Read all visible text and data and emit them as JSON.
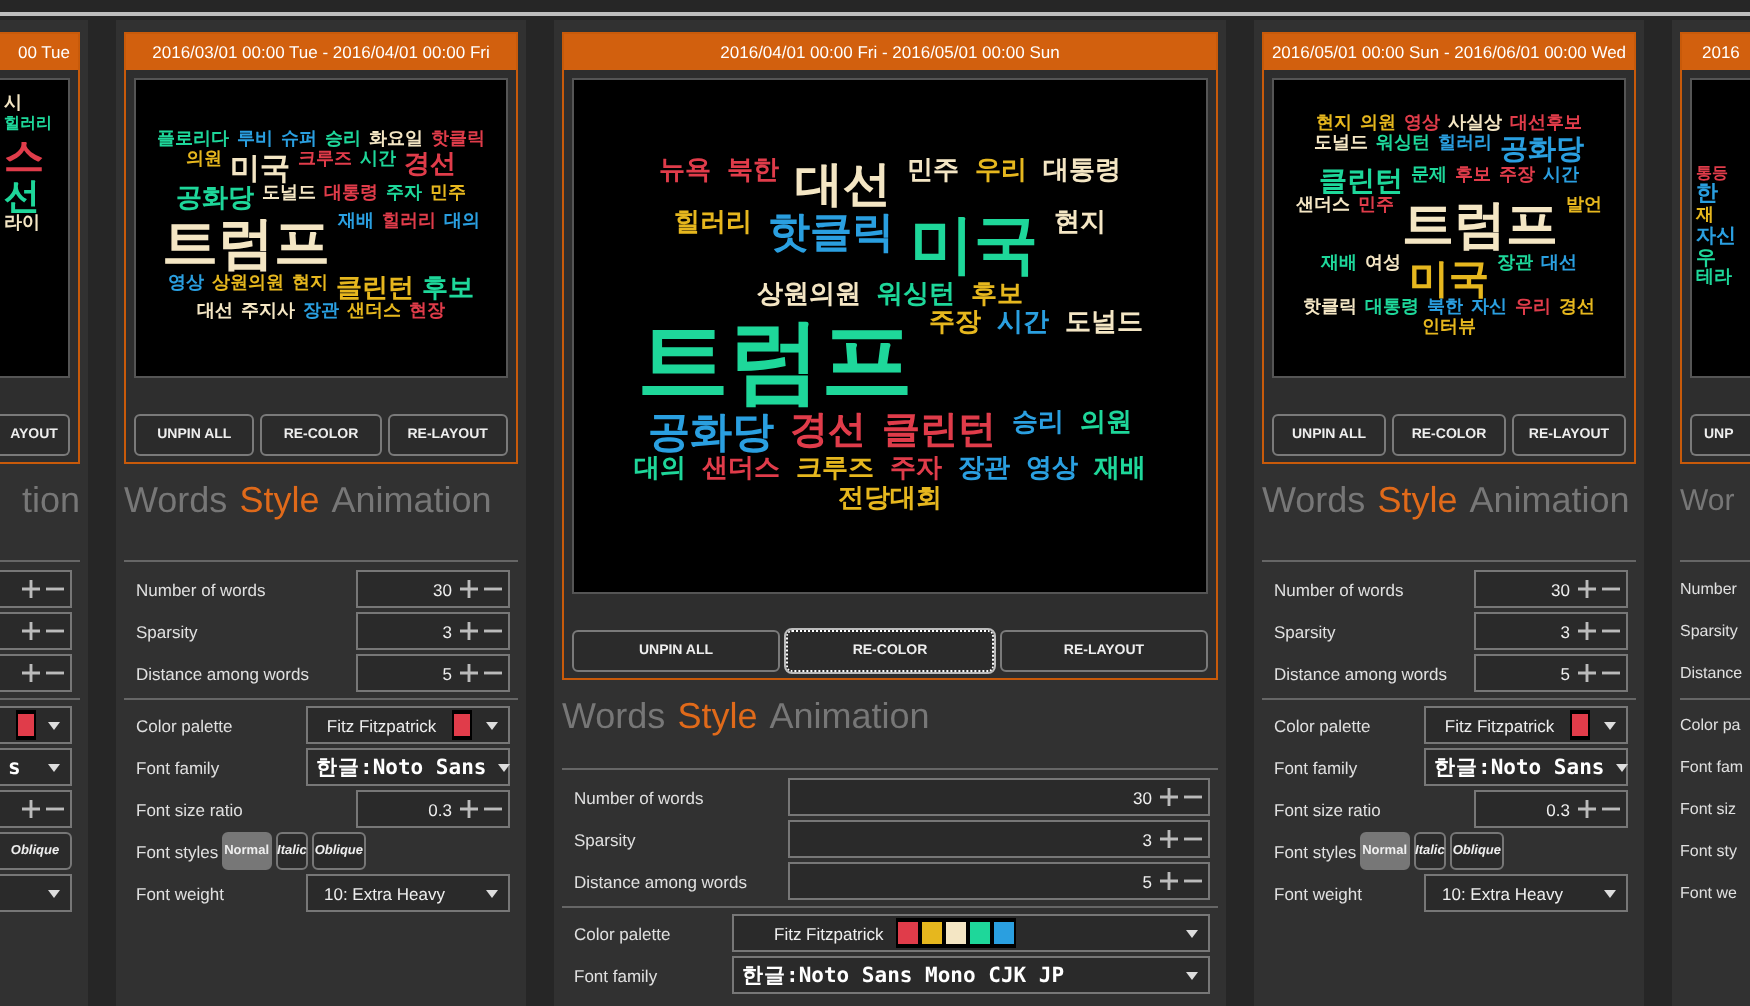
{
  "panels": [
    {
      "kind": "partial-left",
      "range": "00 Tue",
      "words": [
        {
          "text": "시",
          "color": "#f4e6c4"
        },
        {
          "text": "힐러리",
          "color": "#1ed79a"
        },
        {
          "text": "스",
          "color": "#e03c4a"
        },
        {
          "text": "선",
          "color": "#1ed79a"
        },
        {
          "text": "라이",
          "color": "#f4e6c4"
        }
      ],
      "buttons": [
        {
          "label": "AYOUT",
          "focused": false
        }
      ],
      "tabs": [
        {
          "label": "tion",
          "selected": false
        }
      ],
      "settings": [
        {
          "kind": "number"
        },
        {
          "kind": "number"
        },
        {
          "kind": "number"
        },
        {
          "kind": "palette",
          "swatches": [
            {
              "color": "#e03c4a"
            }
          ]
        },
        {
          "kind": "font",
          "value": "s"
        },
        {
          "kind": "number"
        },
        {
          "kind": "styles",
          "options": [
            {
              "label": "Oblique",
              "selected": false
            }
          ]
        },
        {
          "kind": "select"
        }
      ]
    },
    {
      "kind": "full",
      "range": "2016/03/01 00:00 Tue - 2016/04/01 00:00 Fri",
      "words": [
        {
          "text": "플로리다",
          "color": "#1ed79a"
        },
        {
          "text": "루비",
          "color": "#2a9fe0"
        },
        {
          "text": "슈퍼",
          "color": "#2a9fe0"
        },
        {
          "text": "승리",
          "color": "#1ed79a"
        },
        {
          "text": "화요일",
          "color": "#f4e6c4"
        },
        {
          "text": "핫클릭",
          "color": "#e03c4a"
        },
        {
          "text": "의원",
          "color": "#e6b71e"
        },
        {
          "text": "미국",
          "color": "#f4e6c4"
        },
        {
          "text": "크루즈",
          "color": "#e03c4a"
        },
        {
          "text": "시간",
          "color": "#1ed79a"
        },
        {
          "text": "경선",
          "color": "#e03c4a"
        },
        {
          "text": "공화당",
          "color": "#1ed79a"
        },
        {
          "text": "도널드",
          "color": "#f4e6c4"
        },
        {
          "text": "대통령",
          "color": "#e03c4a"
        },
        {
          "text": "주자",
          "color": "#1ed79a"
        },
        {
          "text": "민주",
          "color": "#e6b71e"
        },
        {
          "text": "트럼프",
          "color": "#f4e6c4"
        },
        {
          "text": "재배",
          "color": "#2a9fe0"
        },
        {
          "text": "힐러리",
          "color": "#e03c4a"
        },
        {
          "text": "대의",
          "color": "#2a9fe0"
        },
        {
          "text": "영상",
          "color": "#2a9fe0"
        },
        {
          "text": "상원의원",
          "color": "#e6b71e"
        },
        {
          "text": "현지",
          "color": "#e6b71e"
        },
        {
          "text": "클린턴",
          "color": "#e6b71e"
        },
        {
          "text": "후보",
          "color": "#1ed79a"
        },
        {
          "text": "대선",
          "color": "#f4e6c4"
        },
        {
          "text": "주지사",
          "color": "#f4e6c4"
        },
        {
          "text": "장관",
          "color": "#2a9fe0"
        },
        {
          "text": "샌더스",
          "color": "#e6b71e"
        },
        {
          "text": "현장",
          "color": "#e03c4a"
        }
      ],
      "buttons": [
        {
          "label": "UNPIN ALL",
          "focused": false
        },
        {
          "label": "RE-COLOR",
          "focused": false
        },
        {
          "label": "RE-LAYOUT",
          "focused": false
        }
      ],
      "tabs": [
        {
          "label": "Words",
          "selected": false
        },
        {
          "label": "Style",
          "selected": true
        },
        {
          "label": "Animation",
          "selected": false
        }
      ],
      "settings": [
        {
          "kind": "number",
          "label": "Number of words",
          "value": "30"
        },
        {
          "kind": "number",
          "label": "Sparsity",
          "value": "3"
        },
        {
          "kind": "number",
          "label": "Distance among words",
          "value": "5"
        },
        {
          "kind": "palette",
          "label": "Color palette",
          "value": "Fitz Fitzpatrick",
          "swatches": [
            {
              "color": "#e03c4a"
            }
          ]
        },
        {
          "kind": "font",
          "label": "Font family",
          "value": "한글:Noto Sans"
        },
        {
          "kind": "number",
          "label": "Font size ratio",
          "value": "0.3"
        },
        {
          "kind": "styles",
          "label": "Font styles",
          "options": [
            {
              "label": "Normal",
              "selected": true
            },
            {
              "label": "Italic",
              "selected": false
            },
            {
              "label": "Oblique",
              "selected": false
            }
          ]
        },
        {
          "kind": "select",
          "label": "Font weight",
          "value": "10: Extra Heavy"
        }
      ]
    },
    {
      "kind": "wide",
      "range": "2016/04/01 00:00 Fri - 2016/05/01 00:00 Sun",
      "words": [
        {
          "text": "뉴욕",
          "color": "#e03c4a"
        },
        {
          "text": "북한",
          "color": "#e03c4a"
        },
        {
          "text": "대선",
          "color": "#f4e6c4"
        },
        {
          "text": "민주",
          "color": "#f4e6c4"
        },
        {
          "text": "우리",
          "color": "#e6b71e"
        },
        {
          "text": "대통령",
          "color": "#f4e6c4"
        },
        {
          "text": "힐러리",
          "color": "#e6b71e"
        },
        {
          "text": "핫클릭",
          "color": "#2a9fe0"
        },
        {
          "text": "미국",
          "color": "#1ed79a"
        },
        {
          "text": "현지",
          "color": "#f4e6c4"
        },
        {
          "text": "상원의원",
          "color": "#f4e6c4"
        },
        {
          "text": "워싱턴",
          "color": "#1ed79a"
        },
        {
          "text": "후보",
          "color": "#e6b71e"
        },
        {
          "text": "트럼프",
          "color": "#1ed79a"
        },
        {
          "text": "주장",
          "color": "#e6b71e"
        },
        {
          "text": "시간",
          "color": "#2a9fe0"
        },
        {
          "text": "도널드",
          "color": "#f4e6c4"
        },
        {
          "text": "공화당",
          "color": "#2a9fe0"
        },
        {
          "text": "경선",
          "color": "#e03c4a"
        },
        {
          "text": "클린턴",
          "color": "#e03c4a"
        },
        {
          "text": "승리",
          "color": "#2a9fe0"
        },
        {
          "text": "의원",
          "color": "#1ed79a"
        },
        {
          "text": "대의",
          "color": "#1ed79a"
        },
        {
          "text": "샌더스",
          "color": "#e03c4a"
        },
        {
          "text": "크루즈",
          "color": "#e6b71e"
        },
        {
          "text": "주자",
          "color": "#e03c4a"
        },
        {
          "text": "장관",
          "color": "#2a9fe0"
        },
        {
          "text": "영상",
          "color": "#2a9fe0"
        },
        {
          "text": "재배",
          "color": "#1ed79a"
        },
        {
          "text": "전당대회",
          "color": "#e6b71e"
        }
      ],
      "buttons": [
        {
          "label": "UNPIN ALL",
          "focused": false
        },
        {
          "label": "RE-COLOR",
          "focused": true
        },
        {
          "label": "RE-LAYOUT",
          "focused": false
        }
      ],
      "tabs": [
        {
          "label": "Words",
          "selected": false
        },
        {
          "label": "Style",
          "selected": true
        },
        {
          "label": "Animation",
          "selected": false
        }
      ],
      "settings": [
        {
          "kind": "number",
          "label": "Number of words",
          "value": "30"
        },
        {
          "kind": "number",
          "label": "Sparsity",
          "value": "3"
        },
        {
          "kind": "number",
          "label": "Distance among words",
          "value": "5"
        },
        {
          "kind": "palette",
          "label": "Color palette",
          "value": "Fitz Fitzpatrick",
          "swatches": [
            {
              "color": "#e03c4a"
            },
            {
              "color": "#e6b71e"
            },
            {
              "color": "#f4e6c4"
            },
            {
              "color": "#1ed79a"
            },
            {
              "color": "#2a9fe0"
            }
          ]
        },
        {
          "kind": "font",
          "label": "Font family",
          "value": "한글:Noto Sans Mono CJK JP"
        }
      ]
    },
    {
      "kind": "full",
      "range": "2016/05/01 00:00 Sun - 2016/06/01 00:00 Wed",
      "words": [
        {
          "text": "현지",
          "color": "#e6b71e"
        },
        {
          "text": "의원",
          "color": "#e6b71e"
        },
        {
          "text": "영상",
          "color": "#e03c4a"
        },
        {
          "text": "사실상",
          "color": "#f4e6c4"
        },
        {
          "text": "대선후보",
          "color": "#e03c4a"
        },
        {
          "text": "도널드",
          "color": "#f4e6c4"
        },
        {
          "text": "워싱턴",
          "color": "#1ed79a"
        },
        {
          "text": "힐러리",
          "color": "#2a9fe0"
        },
        {
          "text": "공화당",
          "color": "#2a9fe0"
        },
        {
          "text": "클린턴",
          "color": "#1ed79a"
        },
        {
          "text": "문제",
          "color": "#1ed79a"
        },
        {
          "text": "후보",
          "color": "#e03c4a"
        },
        {
          "text": "주장",
          "color": "#e03c4a"
        },
        {
          "text": "시간",
          "color": "#2a9fe0"
        },
        {
          "text": "샌더스",
          "color": "#f4e6c4"
        },
        {
          "text": "민주",
          "color": "#e03c4a"
        },
        {
          "text": "트럼프",
          "color": "#f4e6c4"
        },
        {
          "text": "발언",
          "color": "#e6b71e"
        },
        {
          "text": "재배",
          "color": "#1ed79a"
        },
        {
          "text": "여성",
          "color": "#f4e6c4"
        },
        {
          "text": "미국",
          "color": "#e6b71e"
        },
        {
          "text": "장관",
          "color": "#1ed79a"
        },
        {
          "text": "대선",
          "color": "#2a9fe0"
        },
        {
          "text": "핫클릭",
          "color": "#f4e6c4"
        },
        {
          "text": "대통령",
          "color": "#1ed79a"
        },
        {
          "text": "북한",
          "color": "#2a9fe0"
        },
        {
          "text": "자신",
          "color": "#2a9fe0"
        },
        {
          "text": "우리",
          "color": "#e03c4a"
        },
        {
          "text": "경선",
          "color": "#e6b71e"
        },
        {
          "text": "인터뷰",
          "color": "#e6b71e"
        }
      ],
      "buttons": [
        {
          "label": "UNPIN ALL",
          "focused": false
        },
        {
          "label": "RE-COLOR",
          "focused": false
        },
        {
          "label": "RE-LAYOUT",
          "focused": false
        }
      ],
      "tabs": [
        {
          "label": "Words",
          "selected": false
        },
        {
          "label": "Style",
          "selected": true
        },
        {
          "label": "Animation",
          "selected": false
        }
      ],
      "settings": [
        {
          "kind": "number",
          "label": "Number of words",
          "value": "30"
        },
        {
          "kind": "number",
          "label": "Sparsity",
          "value": "3"
        },
        {
          "kind": "number",
          "label": "Distance among words",
          "value": "5"
        },
        {
          "kind": "palette",
          "label": "Color palette",
          "value": "Fitz Fitzpatrick",
          "swatches": [
            {
              "color": "#e03c4a"
            }
          ]
        },
        {
          "kind": "font",
          "label": "Font family",
          "value": "한글:Noto Sans"
        },
        {
          "kind": "number",
          "label": "Font size ratio",
          "value": "0.3"
        },
        {
          "kind": "styles",
          "label": "Font styles",
          "options": [
            {
              "label": "Normal",
              "selected": true
            },
            {
              "label": "Italic",
              "selected": false
            },
            {
              "label": "Oblique",
              "selected": false
            }
          ]
        },
        {
          "kind": "select",
          "label": "Font weight",
          "value": "10: Extra Heavy"
        }
      ]
    },
    {
      "kind": "partial-right",
      "range": "2016",
      "words": [
        {
          "text": "통등",
          "color": "#e03c4a"
        },
        {
          "text": "한",
          "color": "#2a9fe0"
        },
        {
          "text": "재",
          "color": "#e6b71e"
        },
        {
          "text": "자신",
          "color": "#2a9fe0"
        },
        {
          "text": "우",
          "color": "#1ed79a"
        },
        {
          "text": "테라",
          "color": "#1ed79a"
        }
      ],
      "buttons": [
        {
          "label": "UNP",
          "focused": false
        }
      ],
      "tabs": [
        {
          "label": "Wor",
          "selected": false
        }
      ],
      "settings": [
        {
          "kind": "number",
          "label": "Number"
        },
        {
          "kind": "number",
          "label": "Sparsity"
        },
        {
          "kind": "number",
          "label": "Distance"
        },
        {
          "kind": "palette",
          "label": "Color pa"
        },
        {
          "kind": "font",
          "label": "Font fam"
        },
        {
          "kind": "number",
          "label": "Font siz"
        },
        {
          "kind": "styles",
          "label": "Font sty"
        },
        {
          "kind": "select",
          "label": "Font we"
        }
      ]
    }
  ]
}
